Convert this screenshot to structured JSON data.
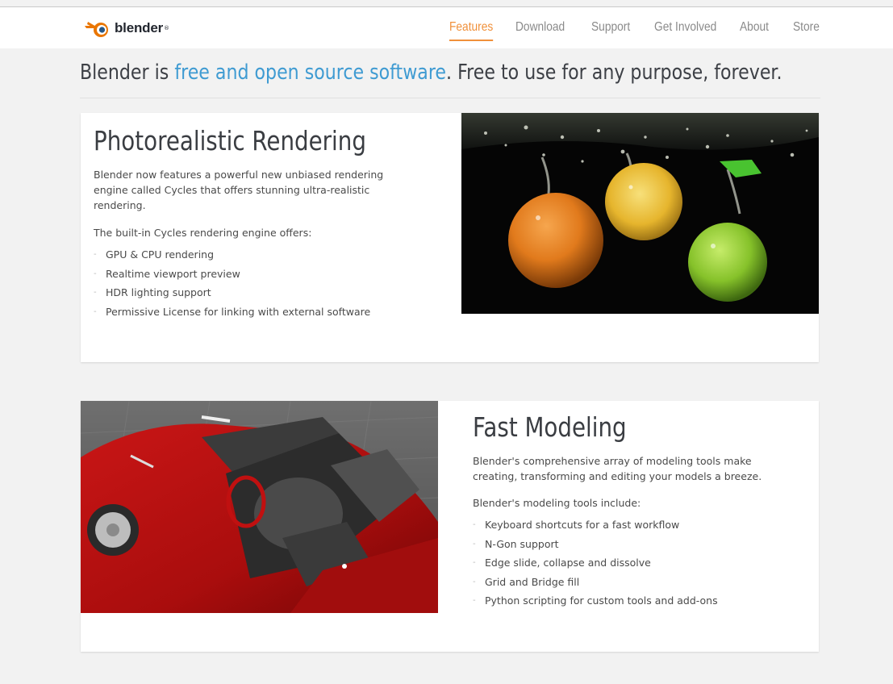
{
  "nav": {
    "logo_text": "blender",
    "logo_tm": "®",
    "items": [
      {
        "label": "Features",
        "active": true
      },
      {
        "label": "Download",
        "active": false
      },
      {
        "label": "Support",
        "active": false
      },
      {
        "label": "Get Involved",
        "active": false
      },
      {
        "label": "About",
        "active": false
      },
      {
        "label": "Store",
        "active": false
      }
    ]
  },
  "headline": {
    "prefix": "Blender is ",
    "link": "free and open source software",
    "suffix": ". Free to use for any purpose, forever."
  },
  "features": [
    {
      "title": "Photorealistic Rendering",
      "description": "Blender now features a powerful new unbiased rendering engine called Cycles that offers stunning ultra-realistic rendering.",
      "intro": "The built-in Cycles rendering engine offers:",
      "items": [
        "GPU & CPU rendering",
        "Realtime viewport preview",
        "HDR lighting support",
        "Permissive License for linking with external software"
      ]
    },
    {
      "title": "Fast Modeling",
      "description": "Blender's comprehensive array of modeling tools make creating, transforming and editing your models a breeze.",
      "intro": "Blender's modeling tools include:",
      "items": [
        "Keyboard shortcuts for a fast workflow",
        "N-Gon support",
        "Edge slide, collapse and dissolve",
        "Grid and Bridge fill",
        "Python scripting for custom tools and add-ons"
      ]
    }
  ],
  "colors": {
    "accent_orange": "#f0903a",
    "link_blue": "#3f9bd2",
    "page_bg": "#f2f2f2"
  }
}
